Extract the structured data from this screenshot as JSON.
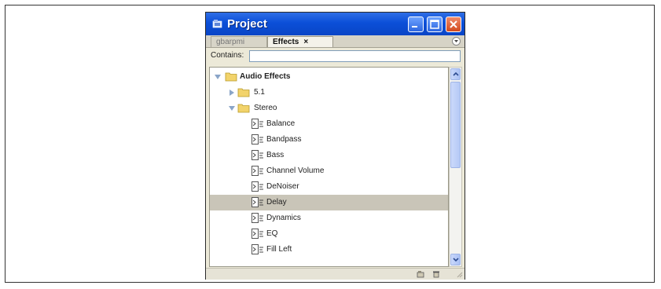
{
  "window": {
    "title": "Project"
  },
  "tabs": [
    {
      "label": "gbarpmi",
      "active": false
    },
    {
      "label": "Effects",
      "active": true,
      "close": "×"
    }
  ],
  "filter": {
    "label": "Contains:",
    "value": ""
  },
  "tree": [
    {
      "label": "Audio Effects",
      "type": "folder",
      "expanded": true,
      "level": 0,
      "bold": true
    },
    {
      "label": "5.1",
      "type": "folder",
      "expanded": false,
      "level": 1
    },
    {
      "label": "Stereo",
      "type": "folder",
      "expanded": true,
      "level": 1
    },
    {
      "label": "Balance",
      "type": "effect",
      "level": 2
    },
    {
      "label": "Bandpass",
      "type": "effect",
      "level": 2
    },
    {
      "label": "Bass",
      "type": "effect",
      "level": 2
    },
    {
      "label": "Channel Volume",
      "type": "effect",
      "level": 2
    },
    {
      "label": "DeNoiser",
      "type": "effect",
      "level": 2
    },
    {
      "label": "Delay",
      "type": "effect",
      "level": 2,
      "selected": true
    },
    {
      "label": "Dynamics",
      "type": "effect",
      "level": 2
    },
    {
      "label": "EQ",
      "type": "effect",
      "level": 2
    },
    {
      "label": "Fill Left",
      "type": "effect",
      "level": 2
    }
  ],
  "icons": {
    "folder": "folder-icon",
    "effect": "audio-effect-icon",
    "bottom": [
      "new-bin-icon",
      "trash-icon"
    ]
  },
  "colors": {
    "titlebar": "#0b4fd8",
    "selection": "#c9c5b8",
    "folder": "#f2d36b"
  }
}
